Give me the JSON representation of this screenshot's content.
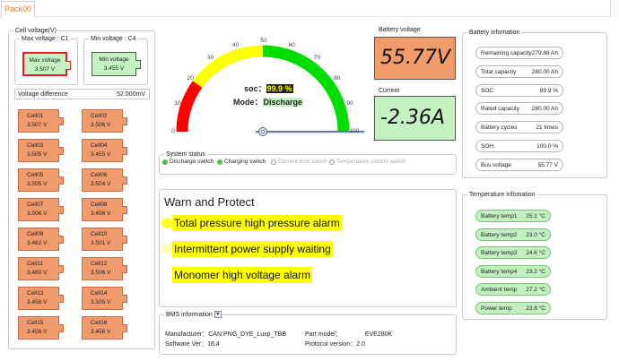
{
  "tab": {
    "label": "Pack00"
  },
  "cell_voltage": {
    "title": "Cell voltage(V)",
    "max": {
      "title": "Max voltage : C1",
      "label": "Max voltage",
      "value": "3.507 V"
    },
    "min": {
      "title": "Min voltage : C4",
      "label": "Min voltage",
      "value": "3.455 V"
    },
    "diff_label": "Voltage difference",
    "diff_value": "52.000mV",
    "cells": [
      {
        "name": "Cell01",
        "value": "3.507 V"
      },
      {
        "name": "Cell02",
        "value": "3.506 V"
      },
      {
        "name": "Cell03",
        "value": "3.505 V"
      },
      {
        "name": "Cell04",
        "value": "3.455 V"
      },
      {
        "name": "Cell05",
        "value": "3.505 V"
      },
      {
        "name": "Cell06",
        "value": "3.504 V"
      },
      {
        "name": "Cell07",
        "value": "3.506 V"
      },
      {
        "name": "Cell08",
        "value": "3.456 V"
      },
      {
        "name": "Cell09",
        "value": "3.462 V"
      },
      {
        "name": "Cell10",
        "value": "3.501 V"
      },
      {
        "name": "Cell11",
        "value": "3.480 V"
      },
      {
        "name": "Cell12",
        "value": "3.506 V"
      },
      {
        "name": "Cell13",
        "value": "3.458 V"
      },
      {
        "name": "Cell14",
        "value": "3.505 V"
      },
      {
        "name": "Cell15",
        "value": "3.456 V"
      },
      {
        "name": "Cell16",
        "value": "3.456 V"
      }
    ]
  },
  "gauge": {
    "soc_label": "soc：",
    "soc_value": "99.9 %",
    "soc_fraction": 0.999,
    "mode_label": "Mode：",
    "mode_value": "Discharge",
    "ticks": [
      "0",
      "10",
      "20",
      "30",
      "40",
      "50",
      "60",
      "70",
      "80",
      "90",
      "100"
    ],
    "colors": {
      "low": "#ff0000",
      "mid": "#ffff00",
      "high": "#00dd00"
    }
  },
  "battery_voltage": {
    "title": "Battery voltage",
    "value": "55.77V",
    "color": "#f29c6a"
  },
  "current": {
    "title": "Current",
    "value": "-2.36A",
    "color": "#c4f2c0"
  },
  "system_status": {
    "title": "System status",
    "items": [
      {
        "label": "Discharge switch",
        "on": true
      },
      {
        "label": "Charging switch",
        "on": true
      },
      {
        "label": "Current limit switch",
        "on": false
      },
      {
        "label": "Temperature control switch",
        "on": false
      }
    ]
  },
  "warn": {
    "title": "Warn and Protect",
    "alarms": [
      "Total pressure high pressure alarm",
      "Intermittent power supply waiting",
      "Monomer high voltage alarm"
    ],
    "alarm_color": "#ffff00"
  },
  "bms": {
    "title": "BMS information",
    "manufacturer_label": "Manufacturer：",
    "manufacturer_value": "CAN:PNG_DYE_Luxp_TBB",
    "software_label": "Software Ver：",
    "software_value": "16.4",
    "part_label": "Part model：",
    "part_value": "EVE280K",
    "protocol_label": "Protocol version：",
    "protocol_value": "2.0"
  },
  "battery_info": {
    "title": "Battery infomation",
    "rows": [
      {
        "label": "Remaining capacity",
        "value": "279.88 Ah"
      },
      {
        "label": "Total capacity",
        "value": "280.00 Ah"
      },
      {
        "label": "SOC",
        "value": "99.9 %"
      },
      {
        "label": "Rated capacity",
        "value": "280.00 Ah"
      },
      {
        "label": "Battery cycles",
        "value": "21 times"
      },
      {
        "label": "SOH",
        "value": "100.0 %"
      },
      {
        "label": "Bus voltage",
        "value": "55.77 V"
      }
    ]
  },
  "temperature_info": {
    "title": "Temperature infomation",
    "rows": [
      {
        "label": "Battery temp1",
        "value": "25.1 °C"
      },
      {
        "label": "Battery temp2",
        "value": "23.0 °C"
      },
      {
        "label": "Battery temp3",
        "value": "24.6 °C"
      },
      {
        "label": "Battery temp4",
        "value": "23.2 °C"
      },
      {
        "label": "Ambient temp",
        "value": "27.2 °C"
      },
      {
        "label": "Power temp",
        "value": "23.8 °C"
      }
    ]
  }
}
